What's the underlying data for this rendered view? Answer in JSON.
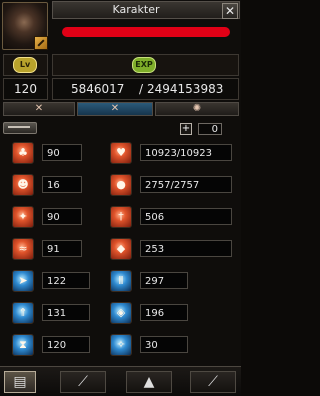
{
  "window": {
    "title": "Karakter",
    "close_glyph": "✕"
  },
  "header": {
    "name_redacted": true
  },
  "level": {
    "label": "Lv",
    "value": "120"
  },
  "exp": {
    "label": "EXP",
    "current": "5846017",
    "separator": "/",
    "max": "2494153983"
  },
  "tabs": [
    {
      "name": "tab-1",
      "icon": "crossed-swords-icon"
    },
    {
      "name": "tab-2",
      "icon": "crossed-swords-blue-icon"
    },
    {
      "name": "tab-3",
      "icon": "emblem-icon"
    }
  ],
  "points": {
    "plus_label": "+",
    "value": "0"
  },
  "left_stats": [
    {
      "name": "stat-strength",
      "icon": "muscle-icon",
      "color": "red",
      "value": "90"
    },
    {
      "name": "stat-intelligence",
      "icon": "head-icon",
      "color": "red",
      "value": "16"
    },
    {
      "name": "stat-dexterity",
      "icon": "foot-icon",
      "color": "red",
      "value": "90"
    },
    {
      "name": "stat-skill",
      "icon": "swoosh-icon",
      "color": "red",
      "value": "91"
    }
  ],
  "right_stats": [
    {
      "name": "stat-hp",
      "icon": "heart-icon",
      "color": "red",
      "value": "10923/10923"
    },
    {
      "name": "stat-mp",
      "icon": "orb-icon",
      "color": "red",
      "value": "2757/2757"
    },
    {
      "name": "stat-attack",
      "icon": "sword-icon",
      "color": "red",
      "value": "506"
    },
    {
      "name": "stat-defense",
      "icon": "shield-icon",
      "color": "red",
      "value": "253"
    }
  ],
  "lower_left_stats": [
    {
      "name": "stat-blue-1",
      "icon": "arrow-icon",
      "color": "blue",
      "value": "122"
    },
    {
      "name": "stat-blue-2",
      "icon": "up-arrows-icon",
      "color": "blue",
      "value": "131"
    },
    {
      "name": "stat-blue-3",
      "icon": "hourglass-icon",
      "color": "blue",
      "value": "120"
    }
  ],
  "lower_right_stats": [
    {
      "name": "stat-blue-4",
      "icon": "pillar-icon",
      "color": "blue",
      "value": "297"
    },
    {
      "name": "stat-blue-5",
      "icon": "shield-blue-icon",
      "color": "blue",
      "value": "196"
    },
    {
      "name": "stat-blue-6",
      "icon": "spark-icon",
      "color": "blue",
      "value": "30"
    }
  ],
  "bottom_tabs": [
    {
      "name": "bottom-tab-character",
      "icon": "portrait-icon",
      "active": true
    },
    {
      "name": "bottom-tab-weapon",
      "icon": "sword-icon",
      "active": false
    },
    {
      "name": "bottom-tab-armor",
      "icon": "armor-icon",
      "active": false
    },
    {
      "name": "bottom-tab-gear",
      "icon": "gear-icon",
      "active": false
    }
  ]
}
